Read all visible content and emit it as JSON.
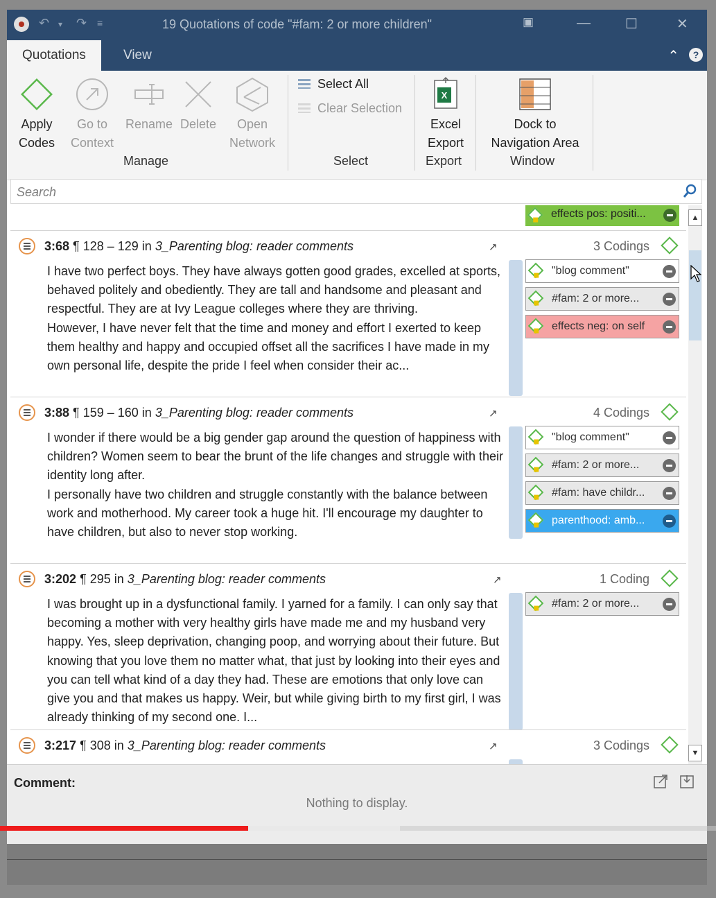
{
  "window": {
    "title": "19 Quotations of code \"#fam: 2 or more  children\""
  },
  "tabs": [
    {
      "label": "Quotations"
    },
    {
      "label": "View"
    }
  ],
  "ribbon": {
    "apply_codes": "Apply\nCodes",
    "go_to_context": "Go to\nContext",
    "rename": "Rename",
    "delete": "Delete",
    "open_network": "Open\nNetwork",
    "manage_group": "Manage",
    "select_all": "Select All",
    "clear_selection": "Clear Selection",
    "select_group": "Select",
    "excel_export": "Excel\nExport",
    "export_group": "Export",
    "dock": "Dock to\nNavigation Area",
    "window_group": "Window"
  },
  "search": {
    "placeholder": "Search"
  },
  "top_partial_chip": {
    "label": "effects pos: positi...",
    "color": "#7cc242"
  },
  "quotations": [
    {
      "id": "3:68",
      "location": "¶ 128 – 129 in",
      "document": "3_Parenting blog: reader comments",
      "codings_label": "3 Codings",
      "text": "I have two perfect boys. They have always gotten good grades, excelled at sports, behaved politely and obediently. They are tall and handsome and pleasant and respectful. They are at Ivy League colleges where they are thriving.\nHowever, I have never felt that the time and money and effort I exerted to keep them healthy and happy and occupied offset all the sacrifices I have made in my own personal life, despite the pride I feel when consider their ac...",
      "codes": [
        {
          "label": "\"blog comment\"",
          "color": "#ffffff"
        },
        {
          "label": "#fam: 2 or more...",
          "color": "#e8e8e8"
        },
        {
          "label": "effects neg: on self",
          "color": "#f5a3a3"
        }
      ]
    },
    {
      "id": "3:88",
      "location": "¶ 159 – 160 in",
      "document": "3_Parenting blog: reader comments",
      "codings_label": "4 Codings",
      "text": "I wonder if there would be a big gender gap around the question of happiness with children? Women seem to bear the brunt of the life changes and struggle with their identity long after.\nI personally have two children and struggle constantly with the balance between work and motherhood. My career took a huge hit. I'll encourage my daughter to have children, but also to never stop working.",
      "codes": [
        {
          "label": "\"blog comment\"",
          "color": "#ffffff"
        },
        {
          "label": "#fam: 2 or more...",
          "color": "#e8e8e8"
        },
        {
          "label": "#fam: have childr...",
          "color": "#e8e8e8"
        },
        {
          "label": "parenthood: amb...",
          "color": "#3aa8ee"
        }
      ]
    },
    {
      "id": "3:202",
      "location": "¶ 295 in",
      "document": "3_Parenting blog: reader comments",
      "codings_label": "1 Coding",
      "text": "I was brought up in a dysfunctional family. I yarned for a family. I can only say that becoming a mother with very healthy girls have made me and my husband very happy. Yes, sleep deprivation, changing poop, and worrying about their future. But knowing that you love them no matter what, that just by looking into their eyes and you can tell what kind of a day they had. These are emotions that only love can give you and that makes us happy. Weir, but while giving birth to my first girl, I was already thinking of my second one. I...",
      "codes": [
        {
          "label": "#fam: 2 or more...",
          "color": "#e8e8e8"
        }
      ]
    },
    {
      "id": "3:217",
      "location": "¶ 308 in",
      "document": "3_Parenting blog: reader comments",
      "codings_label": "3 Codings",
      "text": "",
      "codes": []
    }
  ],
  "comment": {
    "label": "Comment:",
    "empty_text": "Nothing to display."
  },
  "video_progress": {
    "played_fraction": 0.347,
    "buffered_fraction": 0.559
  }
}
